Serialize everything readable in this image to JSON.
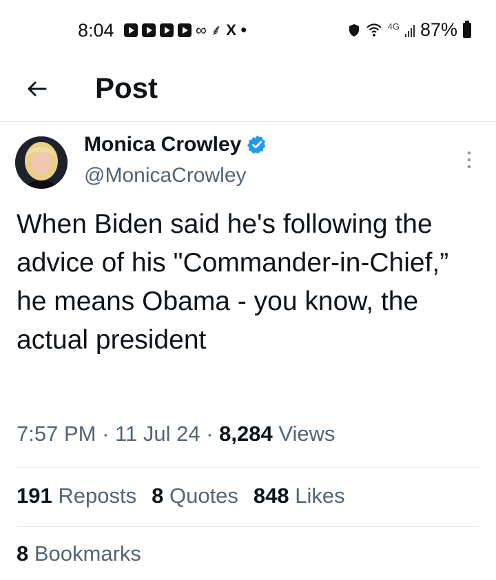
{
  "status_bar": {
    "time": "8:04",
    "network_label": "4G",
    "battery": "87%",
    "notification_icons": [
      "youtube-icon",
      "youtube-icon",
      "youtube-icon",
      "youtube-icon",
      "voicemail-icon",
      "pdf-icon",
      "x-icon",
      "dot-icon"
    ]
  },
  "header": {
    "title": "Post"
  },
  "post": {
    "author_name": "Monica Crowley",
    "author_handle": "@MonicaCrowley",
    "text": "When Biden said he's following the advice of his \"Commander-in-Chief,” he means Obama - you know, the actual president",
    "time": "7:57 PM",
    "separator": "·",
    "date": "11 Jul 24",
    "views_count": "8,284",
    "views_label": "Views",
    "reposts_count": "191",
    "reposts_label": "Reposts",
    "quotes_count": "8",
    "quotes_label": "Quotes",
    "likes_count": "848",
    "likes_label": "Likes",
    "bookmarks_count": "8",
    "bookmarks_label": "Bookmarks"
  },
  "colors": {
    "text_primary": "#0f1419",
    "text_secondary": "#536471",
    "verified_blue": "#1d9bf0",
    "divider": "#e6e8ea"
  }
}
